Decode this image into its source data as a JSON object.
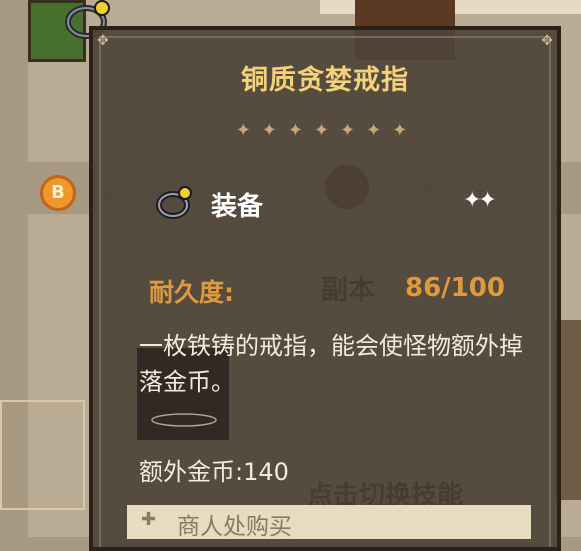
{
  "item": {
    "name": "铜质贪婪戒指",
    "divider_glyphs": "✦✦✦✦✦✦✦",
    "equip_label": "装备",
    "durability_label": "耐久度:",
    "durability_value": "86/100",
    "description": "一枚铁铸的戒指，能会使怪物额外掉落金币。",
    "bonus_text": "额外金币:140",
    "source_text": "商人处购买"
  },
  "background": {
    "coin_value": "1890",
    "gem_value": "465",
    "dungeon_label": "副本",
    "switch_skill_label": "点击切换技能"
  },
  "colors": {
    "title": "#f3d27a",
    "durability": "#e09a3e",
    "panel_bg": "#4e4438",
    "buy_bar": "#e8dcc0"
  }
}
